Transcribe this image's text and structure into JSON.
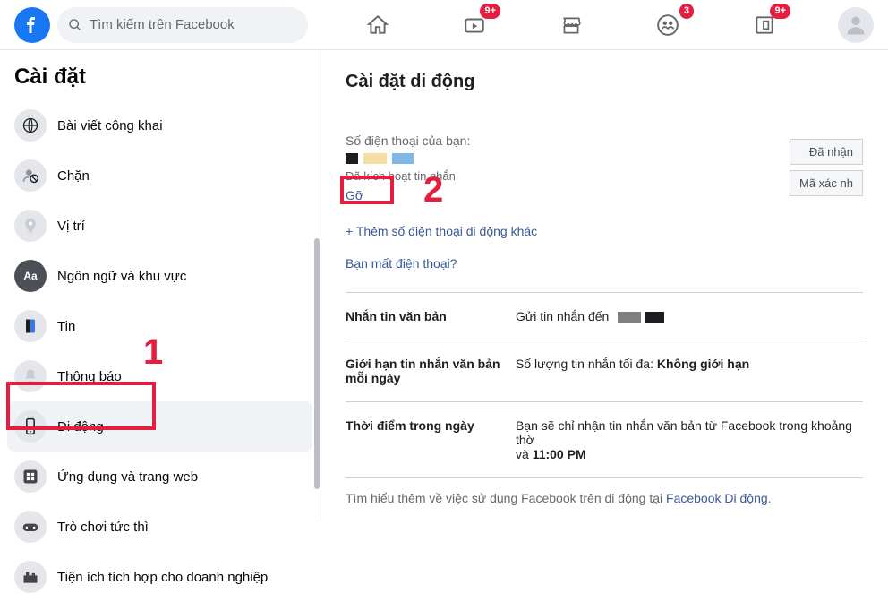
{
  "header": {
    "search_placeholder": "Tìm kiếm trên Facebook",
    "badges": {
      "watch": "9+",
      "groups": "3",
      "gaming": "9+"
    }
  },
  "sidebar": {
    "title": "Cài đặt",
    "items": [
      {
        "label": "Bài viết công khai"
      },
      {
        "label": "Chặn"
      },
      {
        "label": "Vị trí"
      },
      {
        "label": "Ngôn ngữ và khu vực"
      },
      {
        "label": "Tin"
      },
      {
        "label": "Thông báo"
      },
      {
        "label": "Di động"
      },
      {
        "label": "Ứng dụng và trang web"
      },
      {
        "label": "Trò chơi tức thì"
      },
      {
        "label": "Tiện ích tích hợp cho doanh nghiệp"
      }
    ]
  },
  "main": {
    "title": "Cài đặt di động",
    "your_phones_label": "Số điện thoại của bạn:",
    "activated_text": "Đã kích hoạt tin nhắn",
    "remove_label": "Gỡ",
    "add_phone_label": "+ Thêm số điện thoại di động khác",
    "lost_phone_label": "Bạn mất điện thoại?",
    "received_label": "Đã nhận",
    "verify_label": "Mã xác nh",
    "rows": {
      "text_msg": {
        "label": "Nhắn tin văn bản",
        "value": "Gửi tin nhắn đến"
      },
      "daily_limit": {
        "label": "Giới hạn tin nhắn văn bản mỗi ngày",
        "prefix": "Số lượng tin nhắn tối đa:",
        "value": "Không giới hạn"
      },
      "time": {
        "label": "Thời điểm trong ngày",
        "prefix": "Bạn sẽ chỉ nhận tin nhắn văn bản từ Facebook trong khoảng thờ",
        "value1": "11:00 PM"
      }
    },
    "footer_prefix": "Tìm hiểu thêm về việc sử dụng Facebook trên di động tại ",
    "footer_link": "Facebook Di động"
  },
  "annotations": {
    "n1": "1",
    "n2": "2"
  }
}
